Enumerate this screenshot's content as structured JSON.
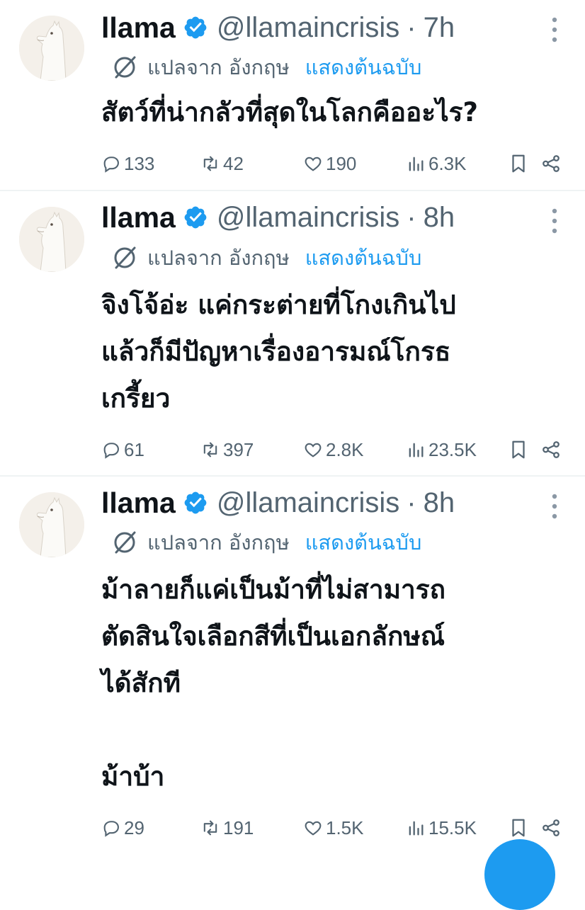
{
  "colors": {
    "accent": "#1d9bf0",
    "secondary_text": "#536471",
    "primary_text": "#0f1419",
    "divider": "#eff3f4"
  },
  "tweets": [
    {
      "name": "llama",
      "handle": "@llamaincrisis",
      "dot": "·",
      "time": "7h",
      "translated_from": "แปลจาก อังกฤษ",
      "show_original": "แสดงต้นฉบับ",
      "text": [
        "สัตว์ที่น่ากลัวที่สุดในโลกคืออะไร?"
      ],
      "replies": "133",
      "retweets": "42",
      "likes": "190",
      "views": "6.3K"
    },
    {
      "name": "llama",
      "handle": "@llamaincrisis",
      "dot": "·",
      "time": "8h",
      "translated_from": "แปลจาก อังกฤษ",
      "show_original": "แสดงต้นฉบับ",
      "text": [
        "จิงโจ้อ่ะ แค่กระต่ายที่โกงเกินไป",
        "แล้วก็มีปัญหาเรื่องอารมณ์โกรธ",
        "เกรี้ยว"
      ],
      "replies": "61",
      "retweets": "397",
      "likes": "2.8K",
      "views": "23.5K"
    },
    {
      "name": "llama",
      "handle": "@llamaincrisis",
      "dot": "·",
      "time": "8h",
      "translated_from": "แปลจาก อังกฤษ",
      "show_original": "แสดงต้นฉบับ",
      "text": [
        "ม้าลายก็แค่เป็นม้าที่ไม่สามารถ",
        "ตัดสินใจเลือกสีที่เป็นเอกลักษณ์",
        "ได้สักที",
        "",
        "ม้าบ้า"
      ],
      "replies": "29",
      "retweets": "191",
      "likes": "1.5K",
      "views": "15.5K"
    }
  ],
  "icons": {
    "avatar": "llama-avatar",
    "verified": "verified-badge-icon",
    "more": "more-vertical-icon",
    "translate": "translate-icon",
    "reply": "reply-icon",
    "retweet": "retweet-icon",
    "like": "heart-icon",
    "views": "views-icon",
    "bookmark": "bookmark-icon",
    "share": "share-icon",
    "compose": "compose-fab"
  }
}
